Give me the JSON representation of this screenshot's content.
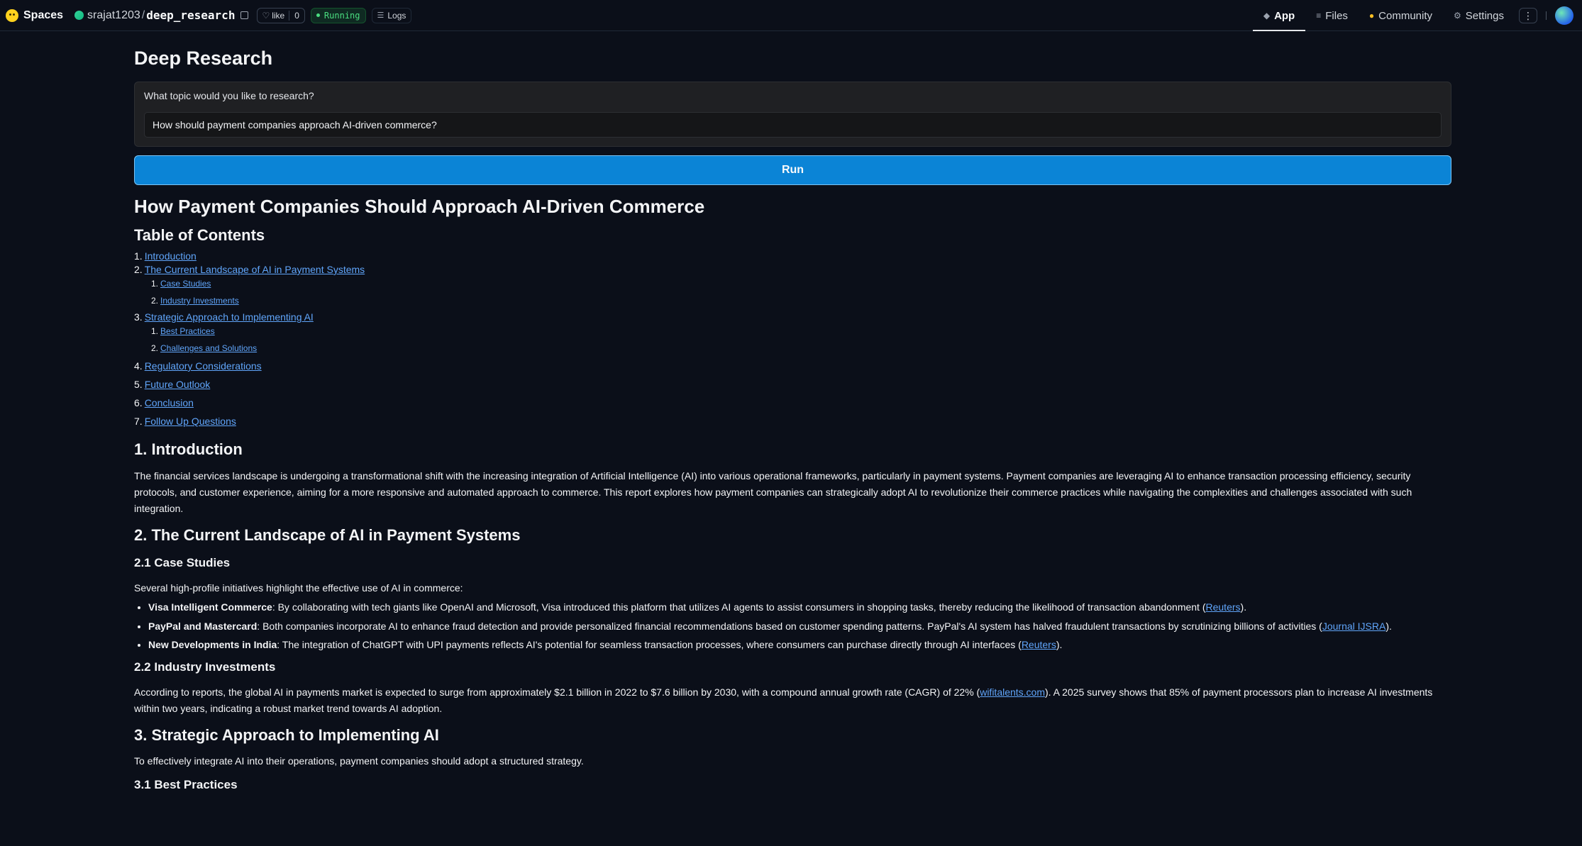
{
  "header": {
    "brand": "Spaces",
    "owner": "srajat1203",
    "repo": "deep_research",
    "like_label": "like",
    "like_count": "0",
    "status": "Running",
    "logs_label": "Logs",
    "nav": [
      {
        "label": "App",
        "icon": "app-icon"
      },
      {
        "label": "Files",
        "icon": "files-icon"
      },
      {
        "label": "Community",
        "icon": "community-icon"
      },
      {
        "label": "Settings",
        "icon": "gear-icon"
      }
    ]
  },
  "app": {
    "title": "Deep Research",
    "input_label": "What topic would you like to research?",
    "input_value": "How should payment companies approach AI-driven commerce?",
    "run_label": "Run"
  },
  "report": {
    "title": "How Payment Companies Should Approach AI-Driven Commerce",
    "toc_heading": "Table of Contents",
    "toc": [
      {
        "num": "1.",
        "label": "Introduction"
      },
      {
        "num": "2.",
        "label": "The Current Landscape of AI in Payment Systems"
      },
      {
        "num": "1.",
        "label": "Case Studies"
      },
      {
        "num": "2.",
        "label": "Industry Investments"
      },
      {
        "num": "3.",
        "label": "Strategic Approach to Implementing AI"
      },
      {
        "num": "1.",
        "label": "Best Practices"
      },
      {
        "num": "2.",
        "label": "Challenges and Solutions"
      },
      {
        "num": "4.",
        "label": "Regulatory Considerations"
      },
      {
        "num": "5.",
        "label": "Future Outlook"
      },
      {
        "num": "6.",
        "label": "Conclusion"
      },
      {
        "num": "7.",
        "label": "Follow Up Questions"
      }
    ],
    "intro_heading": "1. Introduction",
    "intro_text": "The financial services landscape is undergoing a transformational shift with the increasing integration of Artificial Intelligence (AI) into various operational frameworks, particularly in payment systems. Payment companies are leveraging AI to enhance transaction processing efficiency, security protocols, and customer experience, aiming for a more responsive and automated approach to commerce. This report explores how payment companies can strategically adopt AI to revolutionize their commerce practices while navigating the complexities and challenges associated with such integration.",
    "landscape_heading": "2. The Current Landscape of AI in Payment Systems",
    "case_heading": "2.1 Case Studies",
    "case_intro": "Several high-profile initiatives highlight the effective use of AI in commerce:",
    "cases": [
      {
        "bold": "Visa Intelligent Commerce",
        "text": ": By collaborating with tech giants like OpenAI and Microsoft, Visa introduced this platform that utilizes AI agents to assist consumers in shopping tasks, thereby reducing the likelihood of transaction abandonment (",
        "link": "Reuters",
        "tail": ")."
      },
      {
        "bold": "PayPal and Mastercard",
        "text": ": Both companies incorporate AI to enhance fraud detection and provide personalized financial recommendations based on customer spending patterns. PayPal's AI system has halved fraudulent transactions by scrutinizing billions of activities (",
        "link": "Journal IJSRA",
        "tail": ")."
      },
      {
        "bold": "New Developments in India",
        "text": ": The integration of ChatGPT with UPI payments reflects AI's potential for seamless transaction processes, where consumers can purchase directly through AI interfaces (",
        "link": "Reuters",
        "tail": ")."
      }
    ],
    "invest_heading": "2.2 Industry Investments",
    "invest_text_a": "According to reports, the global AI in payments market is expected to surge from approximately $2.1 billion in 2022 to $7.6 billion by 2030, with a compound annual growth rate (CAGR) of 22% (",
    "invest_link": "wifitalents.com",
    "invest_text_b": "). A 2025 survey shows that 85% of payment processors plan to increase AI investments within two years, indicating a robust market trend towards AI adoption.",
    "strategy_heading": "3. Strategic Approach to Implementing AI",
    "strategy_text": "To effectively integrate AI into their operations, payment companies should adopt a structured strategy.",
    "best_heading": "3.1 Best Practices"
  }
}
